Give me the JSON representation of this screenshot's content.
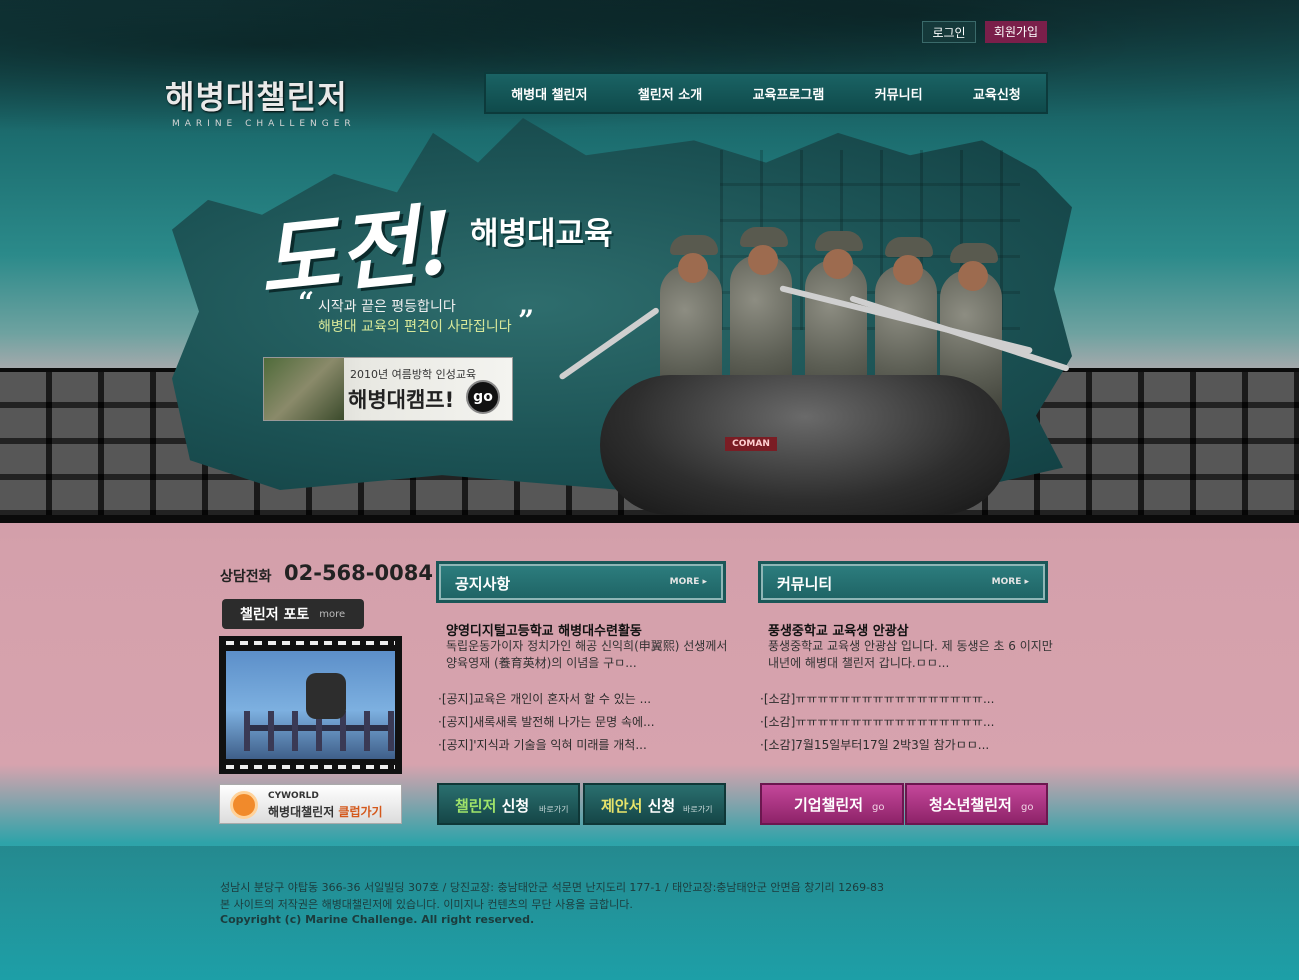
{
  "header": {
    "logo_title": "해병대챌린저",
    "logo_sub": "MARINE CHALLENGER",
    "login": "로그인",
    "join": "회원가입",
    "nav": [
      "해병대 챌린저",
      "챌린저 소개",
      "교육프로그램",
      "커뮤니티",
      "교육신청"
    ]
  },
  "hero": {
    "title": "도전!",
    "subtitle": "해병대교육",
    "quote_open": "“",
    "quote_close": "”",
    "slogan_1": "시작과 끝은 평등합니다",
    "slogan_2": "해병대 교육의 편견이 사라집니다",
    "raft_logo": "COMAN"
  },
  "camp": {
    "line1": "2010년 여름방학 인성교육",
    "line2": "해병대캠프!",
    "go": "go"
  },
  "contact": {
    "label": "상담전화",
    "number": "02-568-0084"
  },
  "photo": {
    "title": "챌린저 포토",
    "more": "more"
  },
  "cyworld": {
    "brand": "CYWORLD",
    "label_prefix": "해병대챌린저 ",
    "label_accent": "클럽가기"
  },
  "notice": {
    "title": "공지사항",
    "more": "MORE ▸",
    "featured_title": "양영디지털고등학교 해병대수련활동",
    "featured_body": "독립운동가이자 정치가인 해공 신익희(申翼熙) 선생께서 양육영재 (養育英材)의 이념을 구ㅁ...",
    "items": [
      "·[공지]교육은 개인이 혼자서 할 수 있는 ...",
      "·[공지]새록새록 발전해 나가는 문명 속에...",
      "·[공지]'지식과 기술을 익혀 미래를 개척..."
    ]
  },
  "community": {
    "title": "커뮤니티",
    "more": "MORE ▸",
    "featured_title": "풍생중학교 교육생 안광삼",
    "featured_body": "풍생중학교 교육생 안광삼 입니다. 제 동생은 초 6 이지만 내년에 해병대 챌린저 갑니다.ㅁㅁ...",
    "items": [
      "·[소감]ㅠㅠㅠㅠㅠㅠㅠㅠㅠㅠㅠㅠㅠㅠㅠㅠㅠ...",
      "·[소감]ㅠㅠㅠㅠㅠㅠㅠㅠㅠㅠㅠㅠㅠㅠㅠㅠㅠ...",
      "·[소감]7월15일부터17일 2박3일 참가ㅁㅁ..."
    ]
  },
  "buttons": {
    "challenger_apply": {
      "main_a": "챌린저",
      "main_b": " 신청",
      "small": "바로가기"
    },
    "proposal_apply": {
      "main_a": "제안서",
      "main_b": " 신청",
      "small": "바로가기"
    },
    "corporate": {
      "label": "기업챌린저",
      "go": "go"
    },
    "youth": {
      "label": "청소년챌린저",
      "go": "go"
    }
  },
  "footer": {
    "line1": "성남시 분당구 야탑동 366-36 서일빌딩 307호  /  당진교장: 충남태안군 석문면 난지도리 177-1  /  태안교장:충남태안군 안면읍 창기리 1269-83",
    "line2": "본 사이트의 저작권은 해병대챌린저에 있습니다. 이미지나 컨텐츠의 무단 사용을 금합니다.",
    "line3": "Copyright (c) Marine Challenge. All right reserved."
  },
  "colors": {
    "teal_dark": "#154647",
    "teal_nav": "#1a6364",
    "pink_button": "#a83381",
    "join_button": "#7a1f4a",
    "background_pink": "#d4a0ab"
  }
}
